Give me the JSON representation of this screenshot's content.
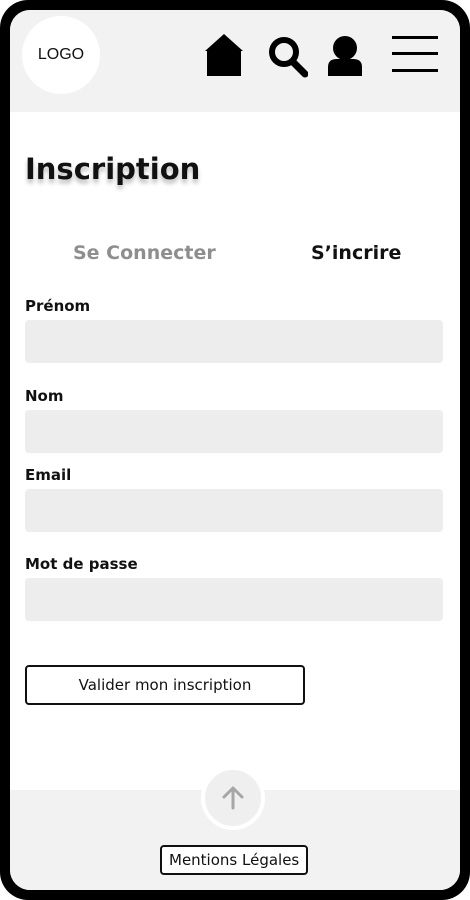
{
  "header": {
    "logo_text": "LOGO",
    "icons": [
      "home-icon",
      "search-icon",
      "user-icon",
      "menu-icon"
    ]
  },
  "page": {
    "title": "Inscription"
  },
  "tabs": {
    "login": "Se Connecter",
    "signup": "S’incrire",
    "active": "signup"
  },
  "form": {
    "first_name_label": "Prénom",
    "first_name_value": "",
    "last_name_label": "Nom",
    "last_name_value": "",
    "email_label": "Email",
    "email_value": "",
    "password_label": "Mot de passe",
    "password_value": "",
    "submit_label": "Valider mon inscription"
  },
  "footer": {
    "scroll_top_icon": "arrow-up-icon",
    "legal_label": "Mentions Légales"
  },
  "colors": {
    "frame": "#000000",
    "header_bg": "#f2f2f2",
    "input_bg": "#ededed",
    "inactive_tab": "#8e8e8e",
    "text": "#111111"
  }
}
